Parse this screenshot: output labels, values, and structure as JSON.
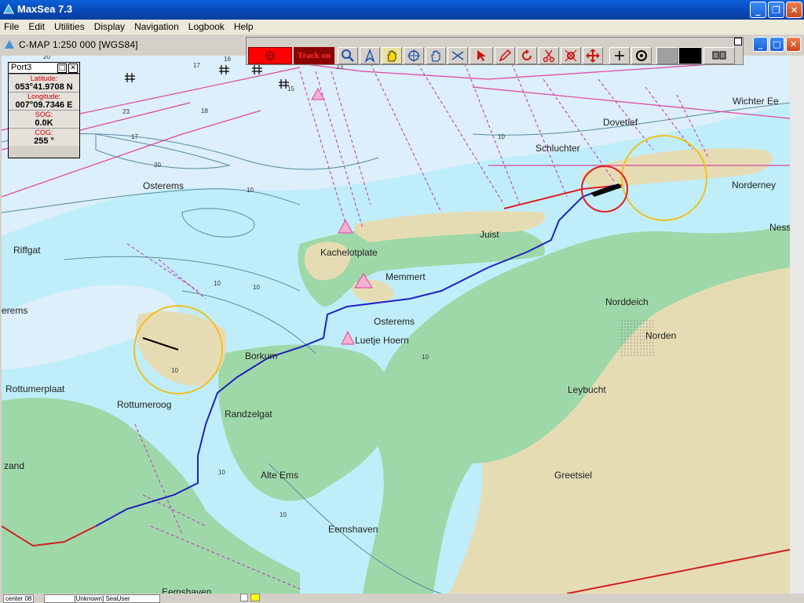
{
  "app": {
    "title": "MaxSea 7.3"
  },
  "menu": [
    "File",
    "Edit",
    "Utilities",
    "Display",
    "Navigation",
    "Logbook",
    "Help"
  ],
  "chart_window": {
    "title": "C-MAP  1:250 000 [WGS84]"
  },
  "toolbar": {
    "track_label": "Track on"
  },
  "info_panel": {
    "title": "Port3",
    "latitude_label": "Latitude:",
    "latitude": "053°41.9708 N",
    "longitude_label": "Longitude:",
    "longitude": "007°09.7346 E",
    "sog_label": "SOG:",
    "sog": "0.0K",
    "cog_label": "COG:",
    "cog": "255 °"
  },
  "map_labels": {
    "wichter_ee": "Wichter Ee",
    "dovetief": "Dovetief",
    "schluchter": "Schluchter",
    "norderney": "Norderney",
    "ness": "Ness",
    "osterems1": "Osterems",
    "riffgat": "Riffgat",
    "kachelotplate": "Kachelotplate",
    "juist": "Juist",
    "memmert": "Memmert",
    "norddeich": "Norddeich",
    "norden": "Norden",
    "osterems2": "Osterems",
    "luetje_hoern": "Luetje Hoern",
    "erems": "erems",
    "borkum": "Borkum",
    "leybucht": "Leybucht",
    "rottumerplaat": "Rottumerplaat",
    "rottumeroog": "Rottumeroog",
    "randzelgat": "Randzelgat",
    "zand": "zand",
    "greetsiel": "Greetsiel",
    "alte_ems": "Alte Ems",
    "eemshaven1": "Eemshaven",
    "eemshaven2": "Eemshaven"
  },
  "soundings": [
    "20",
    "17",
    "16",
    "13",
    "15",
    "18",
    "23",
    "17",
    "20",
    "10",
    "10",
    "10",
    "10",
    "10",
    "10",
    "10",
    "10"
  ],
  "status_bar": {
    "cell1": "center 08",
    "cell2": "[Unknown]  SeaUser"
  }
}
